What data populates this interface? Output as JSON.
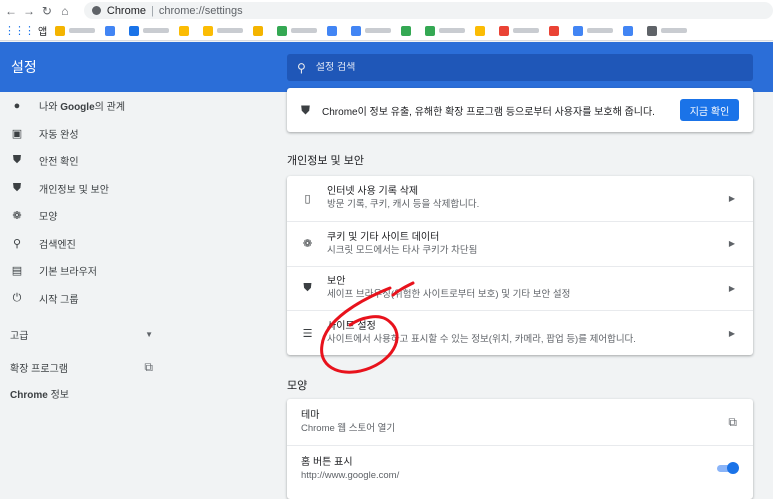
{
  "browser": {
    "tab_title": "Chrome",
    "url": "chrome://settings",
    "apps_label": "앱"
  },
  "bookmark_colors": [
    "#f4b400",
    "#4285f4",
    "#1a73e8",
    "#fbbc04",
    "#fbbc04",
    "#f4b400",
    "#34a853",
    "#4285f4",
    "#4285f4",
    "#34a853",
    "#34a853",
    "#fbbc04",
    "#ea4335",
    "#ea4335",
    "#4285f4",
    "#4285f4",
    "#5f6368"
  ],
  "header": {
    "title": "설정",
    "search_placeholder": "설정 검색"
  },
  "sidebar": {
    "items": [
      {
        "icon": "person-icon",
        "label_bold": "Google",
        "label_pre": "나와 ",
        "label_post": "의 관계"
      },
      {
        "icon": "clipboard-icon",
        "label": "자동 완성"
      },
      {
        "icon": "shield-check-icon",
        "label": "안전 확인"
      },
      {
        "icon": "shield-icon",
        "label": "개인정보 및 보안"
      },
      {
        "icon": "palette-icon",
        "label": "모양"
      },
      {
        "icon": "search-icon",
        "label": "검색엔진"
      },
      {
        "icon": "browser-icon",
        "label": "기본 브라우저"
      },
      {
        "icon": "power-icon",
        "label": "시작 그룹"
      }
    ],
    "advanced": "고급",
    "extensions": "확장 프로그램",
    "about": "Chrome 정보"
  },
  "safety": {
    "text": "Chrome이 정보 유출, 유해한 확장 프로그램 등으로부터 사용자를 보호해 줍니다.",
    "button": "지금 확인"
  },
  "privacy": {
    "title": "개인정보 및 보안",
    "rows": [
      {
        "icon": "trash-icon",
        "label": "인터넷 사용 기록 삭제",
        "sub": "방문 기록, 쿠키, 캐시 등을 삭제합니다."
      },
      {
        "icon": "cookie-icon",
        "label": "쿠키 및 기타 사이트 데이터",
        "sub": "시크릿 모드에서는 타사 쿠키가 차단됨"
      },
      {
        "icon": "security-shield-icon",
        "label": "보안",
        "sub": "세이프 브라우징(위험한 사이트로부터 보호) 및 기타 보안 설정"
      },
      {
        "icon": "site-settings-icon",
        "label": "사이트 설정",
        "sub": "사이트에서 사용하고 표시할 수 있는 정보(위치, 카메라, 팝업 등)를 제어합니다."
      }
    ]
  },
  "appearance": {
    "title": "모양",
    "theme_label": "테마",
    "theme_sub": "Chrome 웹 스토어 열기",
    "home_label": "홈 버튼 표시",
    "home_sub": "http://www.google.com/",
    "home_enabled": true
  },
  "colors": {
    "header_blue": "#2b6ed8",
    "accent": "#1a73e8",
    "annotation_red": "#e8121c"
  }
}
